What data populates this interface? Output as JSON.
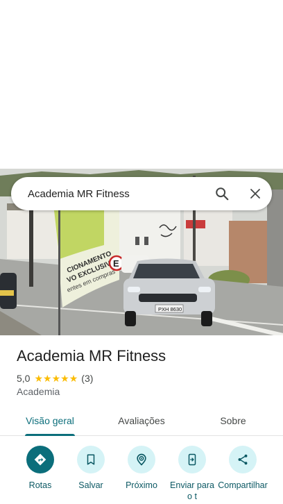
{
  "search": {
    "query": "Academia MR Fitness"
  },
  "photo": {
    "sign_lines": [
      "CIONAMENTO",
      "VO EXCLUSIVO",
      "entes em compras"
    ],
    "sign_letter": "E",
    "plate": "PXH 8630"
  },
  "place": {
    "title": "Academia MR Fitness",
    "rating": "5,0",
    "stars": 5,
    "review_count": "(3)",
    "category": "Academia"
  },
  "tabs": [
    {
      "label": "Visão geral",
      "active": true
    },
    {
      "label": "Avaliações",
      "active": false
    },
    {
      "label": "Sobre",
      "active": false
    }
  ],
  "actions": [
    {
      "label": "Rotas",
      "icon": "directions-icon"
    },
    {
      "label": "Salvar",
      "icon": "bookmark-icon"
    },
    {
      "label": "Próximo",
      "icon": "nearby-icon"
    },
    {
      "label": "Enviar para o t",
      "icon": "send-to-phone-icon"
    },
    {
      "label": "Compartilhar",
      "icon": "share-icon"
    }
  ],
  "colors": {
    "accent": "#0b6e7b",
    "chip": "#d5f3f6",
    "star": "#fbbc04"
  }
}
